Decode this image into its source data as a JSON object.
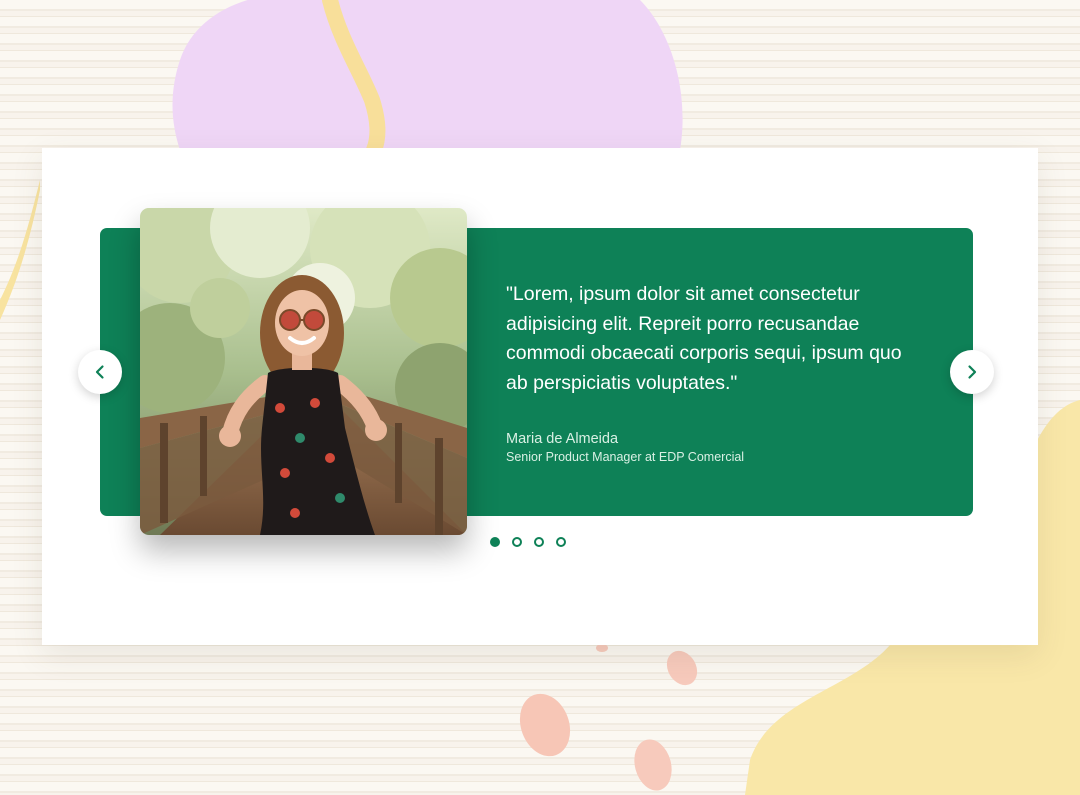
{
  "colors": {
    "accent": "#0e8157",
    "card": "#ffffff",
    "text_on_accent": "#ffffff",
    "blob_purple": "#efd6f6",
    "blob_yellow": "#f9e7a8",
    "blob_peach": "#f7c6b6"
  },
  "testimonial": {
    "quote": "\"Lorem, ipsum dolor sit amet consectetur adipisicing elit. Repreit porro recusandae commodi obcaecati corporis sequi, ipsum quo ab perspiciatis voluptates.\"",
    "author_name": "Maria de Almeida",
    "author_role": "Senior Product Manager at EDP Comercial"
  },
  "navigation": {
    "prev_icon": "chevron-left-icon",
    "next_icon": "chevron-right-icon"
  },
  "pagination": {
    "total": 4,
    "active_index": 0
  }
}
